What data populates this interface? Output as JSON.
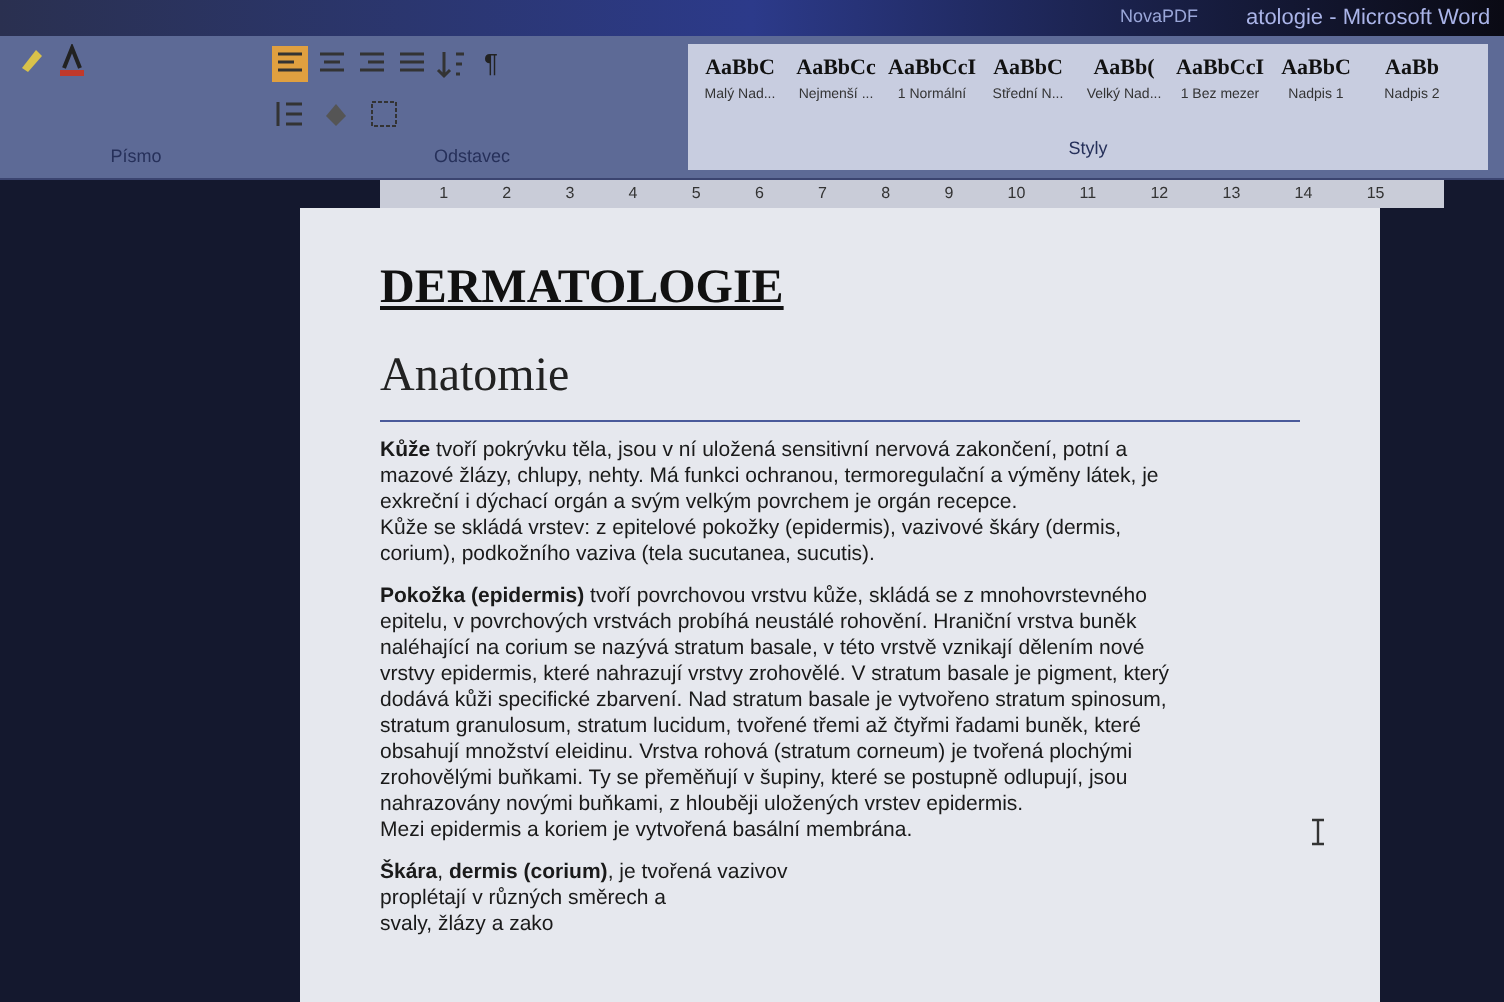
{
  "window": {
    "title": "atologie - Microsoft Word",
    "addin_tab": "NovaPDF"
  },
  "ribbon": {
    "groups": [
      {
        "label": "Písmo"
      },
      {
        "label": "Odstavec"
      },
      {
        "label": "Styly"
      }
    ],
    "pilcrow": "¶",
    "styles": [
      {
        "preview": "AaBbC",
        "name": "Malý Nad..."
      },
      {
        "preview": "AaBbCc",
        "name": "Nejmenší ..."
      },
      {
        "preview": "AaBbCcI",
        "name": "1 Normální"
      },
      {
        "preview": "AaBbC",
        "name": "Střední N..."
      },
      {
        "preview": "AaBb(",
        "name": "Velký Nad..."
      },
      {
        "preview": "AaBbCcI",
        "name": "1 Bez mezer"
      },
      {
        "preview": "AaBbC",
        "name": "Nadpis 1"
      },
      {
        "preview": "AaBb",
        "name": "Nadpis 2"
      }
    ]
  },
  "ruler": {
    "numbers": [
      "1",
      "2",
      "3",
      "4",
      "5",
      "6",
      "7",
      "8",
      "9",
      "10",
      "11",
      "12",
      "13",
      "14",
      "15"
    ]
  },
  "document": {
    "title": "DERMATOLOGIE",
    "heading": "Anatomie",
    "paragraphs": [
      {
        "lines": [
          "**Kůže** tvoří pokrývku těla, jsou v ní uložená sensitivní nervová zakončení, potní a",
          "mazové žlázy, chlupy, nehty. Má funkci ochranou, termoregulační a výměny látek, je",
          "exkreční i dýchací orgán a svým velkým povrchem je orgán recepce.",
          "Kůže se skládá vrstev:  z epitelové pokožky (epidermis), vazivové škáry (dermis,",
          "corium), podkožního vaziva (tela sucutanea, sucutis)."
        ]
      },
      {
        "lines": [
          "**Pokožka (epidermis)** tvoří povrchovou vrstvu kůže, skládá se z mnohovrstevného",
          "epitelu, v povrchových vrstvách probíhá neustálé rohovění. Hraniční vrstva buněk",
          "naléhající na corium se nazývá stratum basale, v této vrstvě vznikají dělením nové",
          "vrstvy epidermis, které nahrazují vrstvy zrohovělé. V stratum basale je pigment, který",
          "dodává kůži specifické zbarvení. Nad stratum basale je vytvořeno stratum spinosum,",
          "stratum granulosum, stratum lucidum, tvořené třemi až čtyřmi řadami buněk, které",
          "obsahují množství eleidinu. Vrstva rohová (stratum corneum) je tvořená plochými",
          "zrohovělými buňkami. Ty se přeměňují v šupiny, které se postupně odlupují, jsou",
          "nahrazovány novými buňkami, z hlouběji uložených vrstev epidermis.",
          "Mezi epidermis a koriem je vytvořená basální membrána."
        ]
      },
      {
        "lines": [
          "**Škára**, **dermis (corium)**, je tvořená vazivov",
          "proplétají v různých směrech a",
          "svaly, žlázy a zako"
        ]
      }
    ]
  }
}
